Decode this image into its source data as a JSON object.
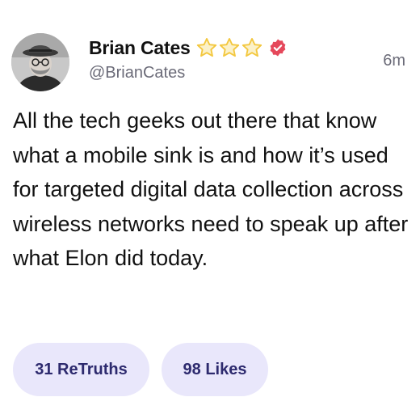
{
  "post": {
    "author": {
      "display_name": "Brian Cates",
      "handle": "@BrianCates",
      "stars": 3,
      "star_icon": "star-icon",
      "verified_icon": "verified-badge-icon",
      "verified_color": "#e5485b",
      "star_color": "#f3c73e"
    },
    "timestamp": "6m",
    "text": "All the tech geeks out there that know what a mobile sink is and how it’s used for targeted digital data collection across wireless networks need to speak up after what Elon did today.",
    "stats": {
      "retruths_label": "31 ReTruths",
      "likes_label": "98 Likes"
    },
    "colors": {
      "pill_background": "#e9e7fb",
      "pill_text": "#2d2a6e",
      "secondary_text": "#6b6b78"
    }
  }
}
